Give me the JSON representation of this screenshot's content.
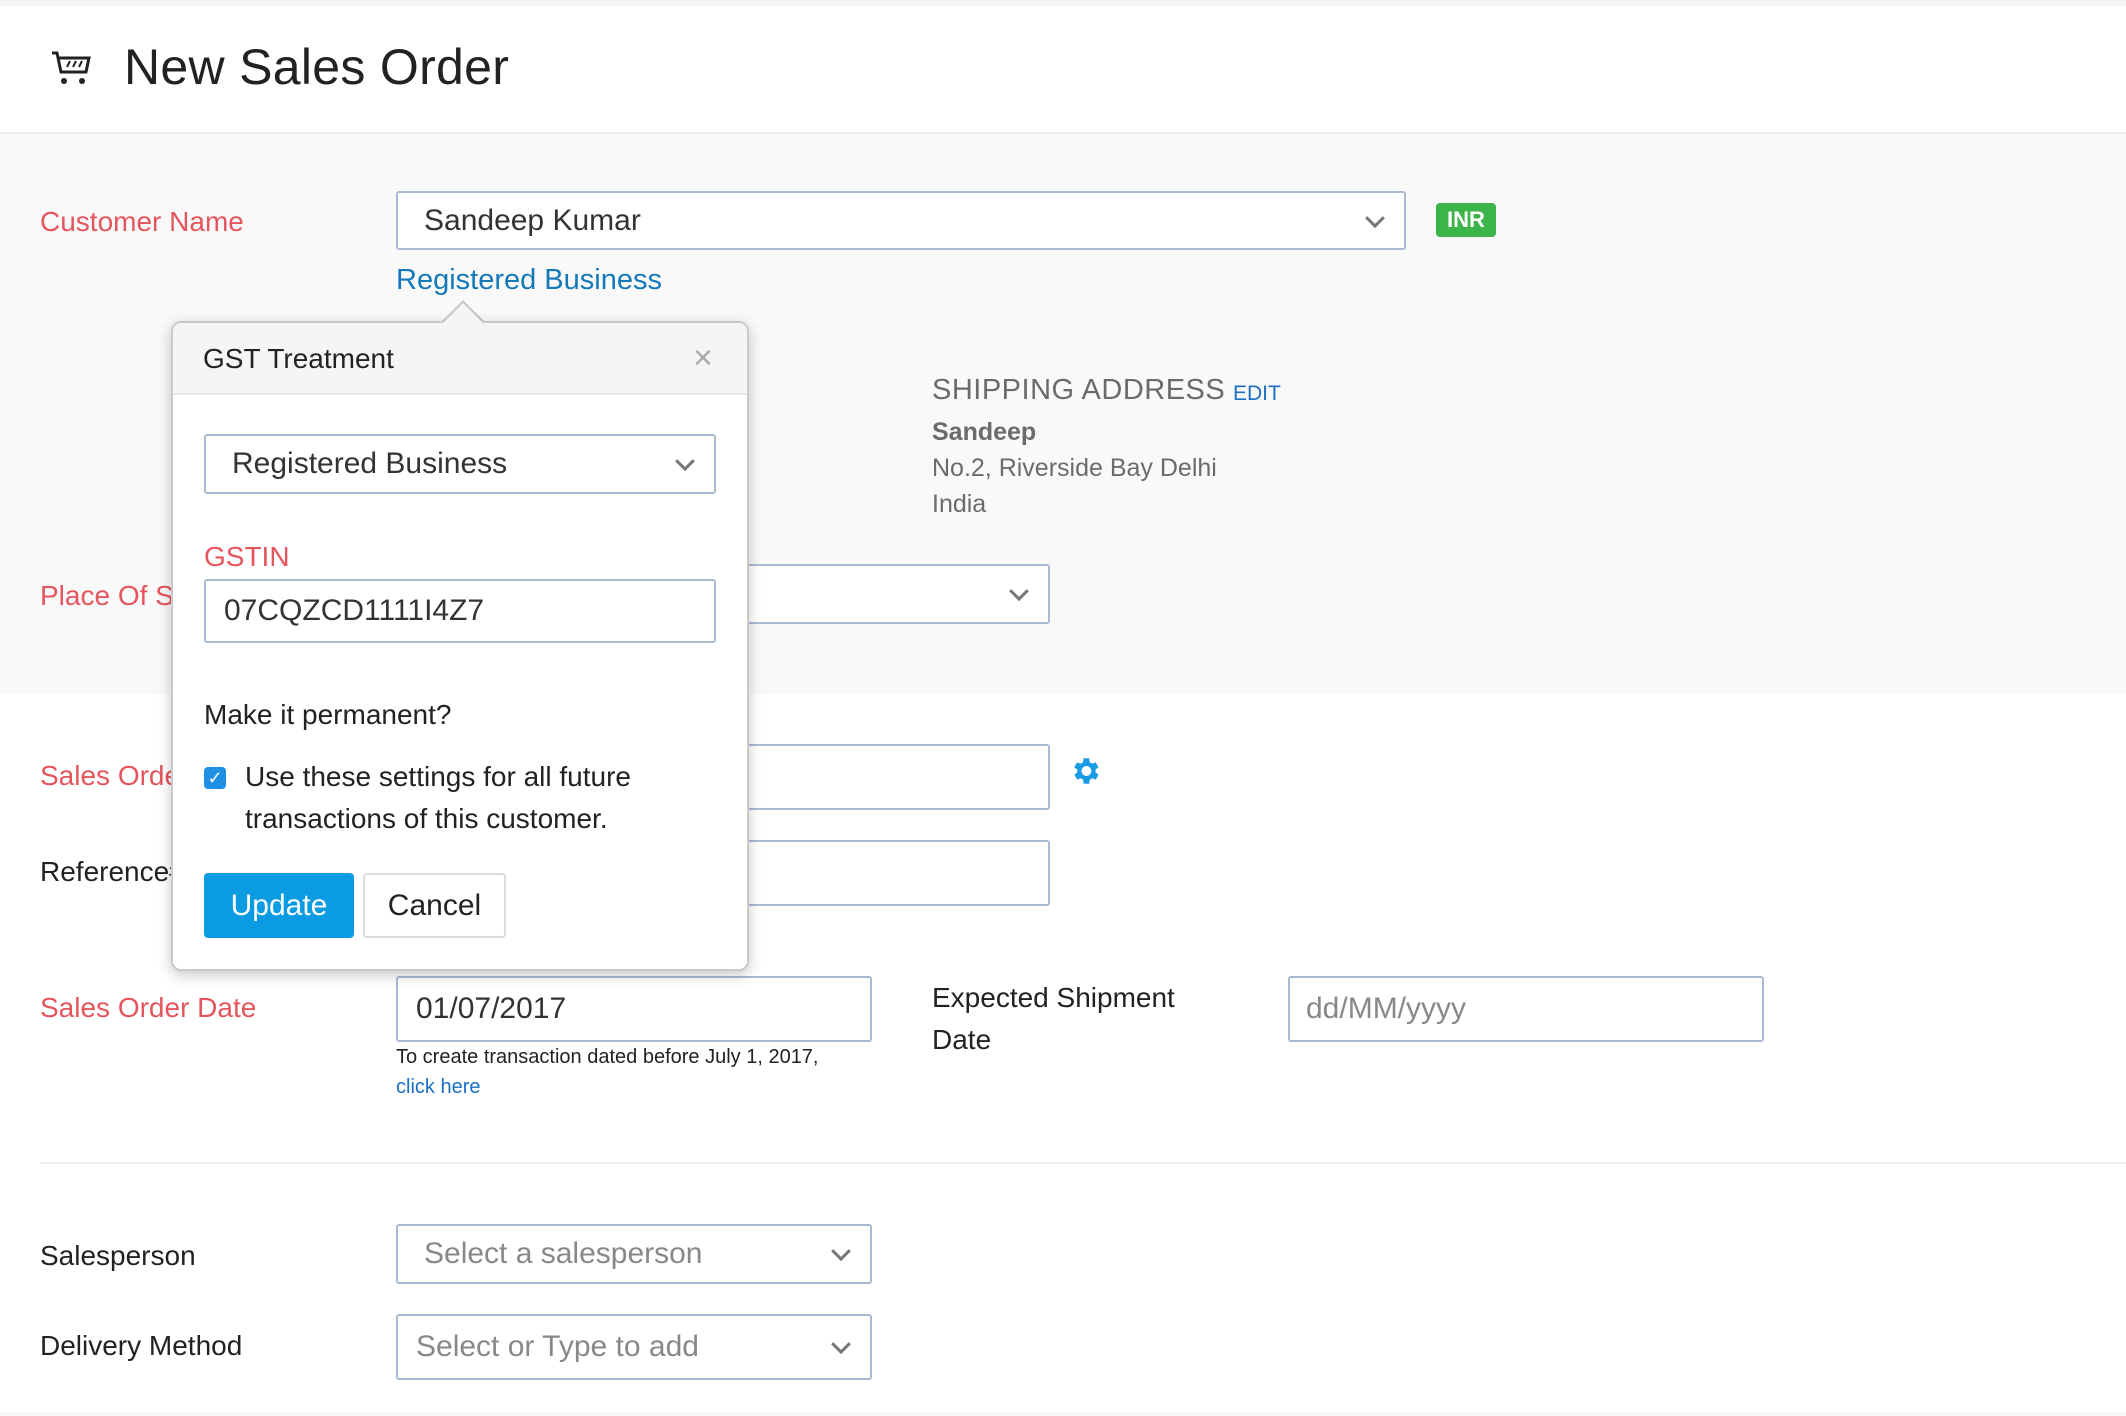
{
  "header": {
    "title": "New Sales Order",
    "icon": "shopping-cart-icon"
  },
  "customer": {
    "label": "Customer Name",
    "value": "Sandeep Kumar",
    "currency_badge": "INR",
    "gst_treatment_link": "Registered Business"
  },
  "shipping_address": {
    "heading": "SHIPPING ADDRESS",
    "edit_label": "EDIT",
    "name": "Sandeep",
    "line1": "No.2, Riverside Bay Delhi",
    "line2": "India"
  },
  "place_of_supply": {
    "label": "Place Of Supply",
    "value": ""
  },
  "sales_order_number": {
    "label": "Sales Order#",
    "value": "",
    "settings_icon": "gear-icon"
  },
  "reference": {
    "label": "Reference#",
    "value": ""
  },
  "sales_order_date": {
    "label": "Sales Order Date",
    "value": "01/07/2017",
    "hint": "To create transaction dated before July 1, 2017,",
    "hint_link": "click here"
  },
  "expected_shipment": {
    "label_line1": "Expected Shipment",
    "label_line2": "Date",
    "placeholder": "dd/MM/yyyy"
  },
  "salesperson": {
    "label": "Salesperson",
    "placeholder": "Select a salesperson"
  },
  "delivery_method": {
    "label": "Delivery Method",
    "placeholder": "Select or Type to add"
  },
  "gst_popover": {
    "title": "GST Treatment",
    "treatment_value": "Registered Business",
    "gstin_label": "GSTIN",
    "gstin_value": "07CQZCD1111I4Z7",
    "permanent_question": "Make it permanent?",
    "checkbox_checked": true,
    "checkbox_line1": "Use these settings for all future",
    "checkbox_line2": "transactions of this customer.",
    "update_label": "Update",
    "cancel_label": "Cancel"
  },
  "colors": {
    "required_label": "#e5555d",
    "link": "#1479b8",
    "primary": "#0a9be3",
    "badge": "#3bb44a"
  }
}
